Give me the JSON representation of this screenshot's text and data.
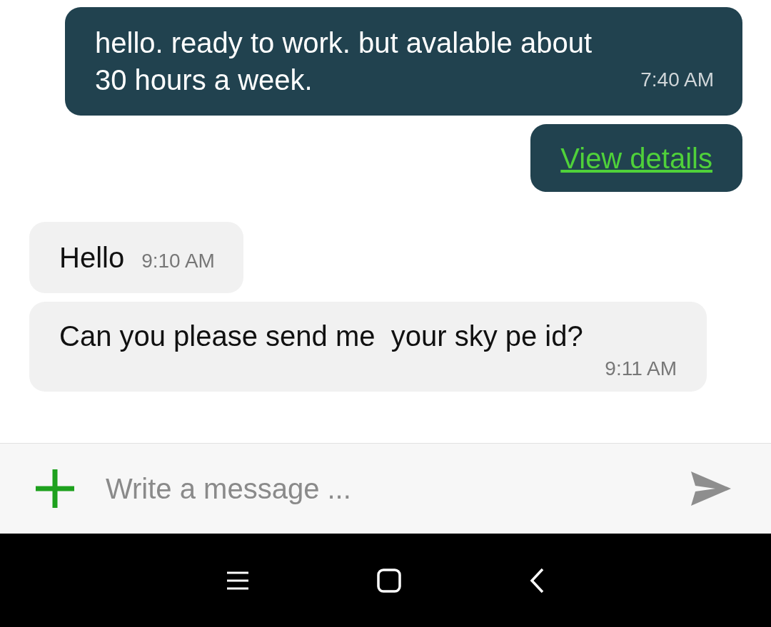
{
  "messages": [
    {
      "outgoing": true,
      "kind": "text",
      "text": "hello. ready to work. but avalable about 30 hours a week.",
      "time": "7:40 AM",
      "time_inline": false
    },
    {
      "outgoing": true,
      "kind": "link",
      "text": "View details"
    },
    {
      "outgoing": false,
      "kind": "text",
      "text": "Hello",
      "time": "9:10 AM",
      "time_inline": true
    },
    {
      "outgoing": false,
      "kind": "text",
      "text": "Can you please send me  your sky pe id?",
      "time": "9:11 AM",
      "time_inline": false
    }
  ],
  "composer": {
    "placeholder": "Write a message ..."
  }
}
